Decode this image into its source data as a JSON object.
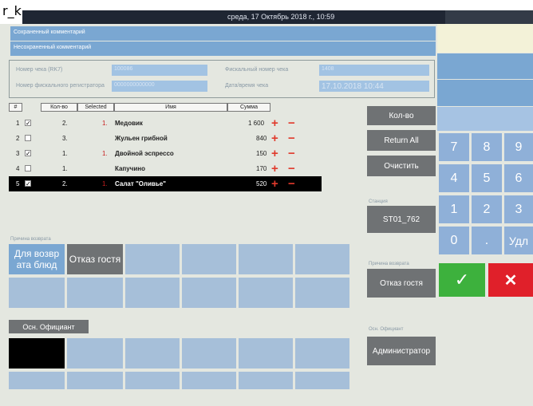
{
  "app": {
    "name": "r_k",
    "datetime": "среда, 17 Октябрь 2018 г., 10:59"
  },
  "comments": {
    "saved": "Сохраненный комментарий",
    "unsaved": "Несохраненный комментарий"
  },
  "receipt": {
    "check_number_label": "Номер чека (RK7)",
    "check_number_value": "100086",
    "fiscal_check_label": "Фискальный номер чека",
    "fiscal_check_value": "1408",
    "fiscal_register_label": "Номер фискального регистратора",
    "fiscal_register_value": "0000000000000",
    "datetime_label": "Дата/время чека",
    "datetime_value": "17.10.2018 10:44"
  },
  "table": {
    "headers": [
      "#",
      "Кол-во",
      "Selected",
      "Имя",
      "Сумма"
    ],
    "rows": [
      {
        "num": "1",
        "checked": true,
        "qty": "2.",
        "selected": "1.",
        "name": "Медовик",
        "sum": "1 600"
      },
      {
        "num": "2",
        "checked": false,
        "qty": "3.",
        "selected": "",
        "name": "Жульен грибной",
        "sum": "840"
      },
      {
        "num": "3",
        "checked": true,
        "qty": "1.",
        "selected": "1.",
        "name": "Двойной эспрессо",
        "sum": "150"
      },
      {
        "num": "4",
        "checked": false,
        "qty": "1.",
        "selected": "",
        "name": "Капучино",
        "sum": "170"
      },
      {
        "num": "5",
        "checked": true,
        "qty": "2.",
        "selected": "1.",
        "name": "Салат \"Оливье\"",
        "sum": "520"
      }
    ],
    "plus": "+",
    "minus": "−"
  },
  "actions": {
    "qty": "Кол-во",
    "return_all": "Return All",
    "clear": "Очистить",
    "station_label": "Станция",
    "station": "ST01_762",
    "reason_label": "Причина возврата",
    "reason": "Отказ гостя",
    "waiter_label": "Осн. Официант",
    "waiter": "Администратор"
  },
  "reasons": {
    "label": "Причина возврата",
    "items": [
      "Для возвр ата блюд",
      "Отказ гостя"
    ]
  },
  "waiter": {
    "button": "Осн. Официант"
  },
  "keypad": {
    "keys": [
      "7",
      "8",
      "9",
      "4",
      "5",
      "6",
      "1",
      "2",
      "3",
      "0",
      ".",
      "Удл"
    ],
    "ok": "✓",
    "cancel": "✕"
  },
  "colors": {
    "accent_blue": "#7aa7d2",
    "ok_green": "#3db13d",
    "cancel_red": "#e0202a",
    "header_dark": "#1f2633"
  }
}
